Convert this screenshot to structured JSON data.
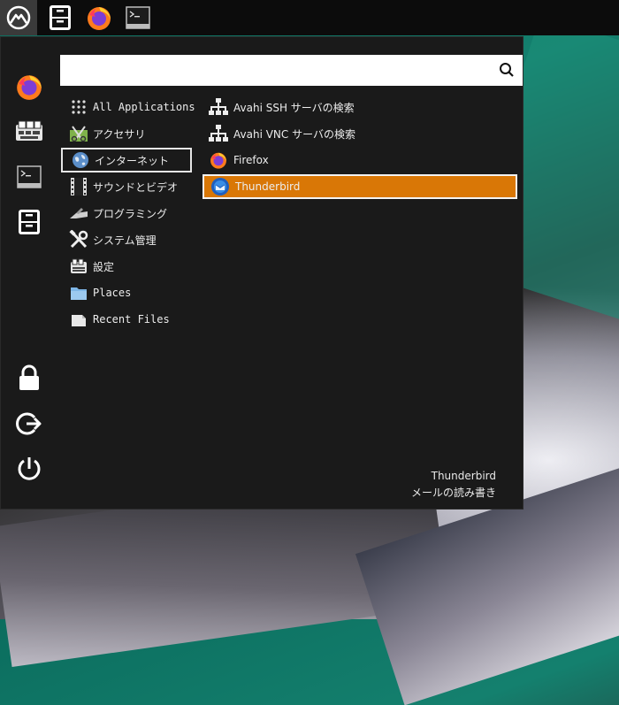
{
  "taskbar": {
    "icons": [
      "start-logo-icon",
      "file-manager-icon",
      "firefox-icon",
      "terminal-icon"
    ]
  },
  "favorites": [
    "firefox-icon",
    "keyboard-settings-icon",
    "terminal-icon",
    "file-manager-icon"
  ],
  "session": [
    "lock-icon",
    "logout-icon",
    "power-icon"
  ],
  "search": {
    "value": "",
    "placeholder": ""
  },
  "categories": [
    {
      "label": "All Applications",
      "icon": "grid-icon"
    },
    {
      "label": "アクセサリ",
      "icon": "accessories-icon"
    },
    {
      "label": "インターネット",
      "icon": "internet-globe-icon",
      "selected": true
    },
    {
      "label": "サウンドとビデオ",
      "icon": "film-strip-icon"
    },
    {
      "label": "プログラミング",
      "icon": "programming-icon"
    },
    {
      "label": "システム管理",
      "icon": "tools-icon"
    },
    {
      "label": "設定",
      "icon": "settings-icon"
    },
    {
      "label": "Places",
      "icon": "folder-icon"
    },
    {
      "label": "Recent Files",
      "icon": "recent-files-icon"
    }
  ],
  "apps": [
    {
      "label": "Avahi SSH サーバの検索",
      "icon": "network-icon"
    },
    {
      "label": "Avahi VNC サーバの検索",
      "icon": "network-icon"
    },
    {
      "label": "Firefox",
      "icon": "firefox-icon"
    },
    {
      "label": "Thunderbird",
      "icon": "thunderbird-icon",
      "highlighted": true
    }
  ],
  "description": {
    "name": "Thunderbird",
    "comment": "メールの読み書き"
  },
  "colors": {
    "highlight": "#d97706",
    "menu_bg": "#1a1a1a",
    "panel_bg": "#0c0c0c"
  }
}
